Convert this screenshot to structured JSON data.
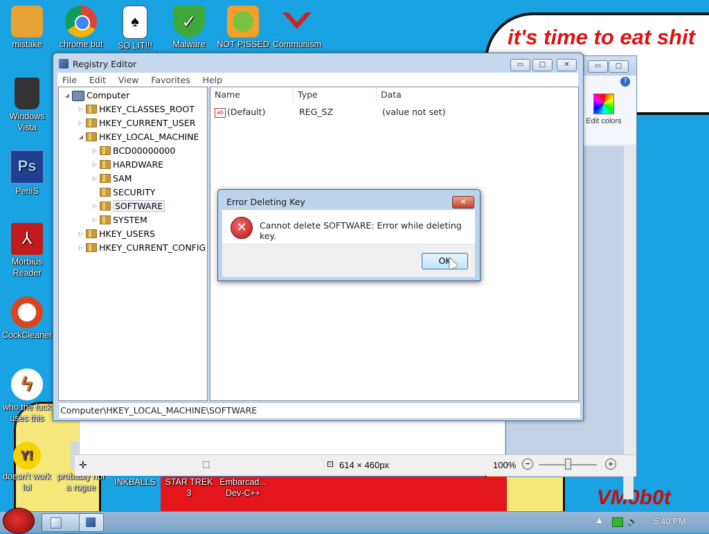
{
  "desktop": {
    "speech_text": "it's time to eat shit\n           chew",
    "watermark": "VM0b0t",
    "icons": [
      {
        "label": "mistake",
        "color": "#e8a335"
      },
      {
        "label": "chrome but",
        "color": "#3b8fe0"
      },
      {
        "label": "SO LIT!!!",
        "color": "#ffffff"
      },
      {
        "label": "Malware",
        "color": "#3fa83a"
      },
      {
        "label": "NOT PISSED",
        "color": "#f2a12a"
      },
      {
        "label": "Communism",
        "color": "#d02020"
      },
      {
        "label": "Windows Vista",
        "color": "#333333"
      },
      {
        "label": "PeniS",
        "color": "#1f3f8f"
      },
      {
        "label": "Morbius Reader",
        "color": "#c21b1b"
      },
      {
        "label": "CockCleaner",
        "color": "#d9451f"
      },
      {
        "label": "who the fuck uses this",
        "color": "#ffffff"
      },
      {
        "label": "doesn't work lol",
        "color": "#7b2fa8"
      },
      {
        "label": "probably not a rogue",
        "color": "#cfd8e8"
      },
      {
        "label": "INKBALLS",
        "color": "#e4151b"
      },
      {
        "label": "STAR TREK 3",
        "color": "#e4151b"
      },
      {
        "label": "Embarcad... Dev-C++",
        "color": "#e4151b"
      }
    ]
  },
  "paint": {
    "edit_colors": "Edit colors",
    "status_size": "614 × 460px",
    "zoom": "100%"
  },
  "regedit": {
    "title": "Registry Editor",
    "menu": [
      "File",
      "Edit",
      "View",
      "Favorites",
      "Help"
    ],
    "tree": {
      "root": "Computer",
      "keys": [
        "HKEY_CLASSES_ROOT",
        "HKEY_CURRENT_USER",
        "HKEY_LOCAL_MACHINE",
        "BCD00000000",
        "HARDWARE",
        "SAM",
        "SECURITY",
        "SOFTWARE",
        "SYSTEM",
        "HKEY_USERS",
        "HKEY_CURRENT_CONFIG"
      ]
    },
    "columns": [
      "Name",
      "Type",
      "Data"
    ],
    "rows": [
      {
        "name": "(Default)",
        "type": "REG_SZ",
        "data": "(value not set)"
      }
    ],
    "status": "Computer\\HKEY_LOCAL_MACHINE\\SOFTWARE"
  },
  "dialog": {
    "title": "Error Deleting Key",
    "message": "Cannot delete SOFTWARE:  Error while deleting key.",
    "ok": "OK",
    "close": "✕"
  },
  "taskbar": {
    "clock": "5:40 PM"
  }
}
